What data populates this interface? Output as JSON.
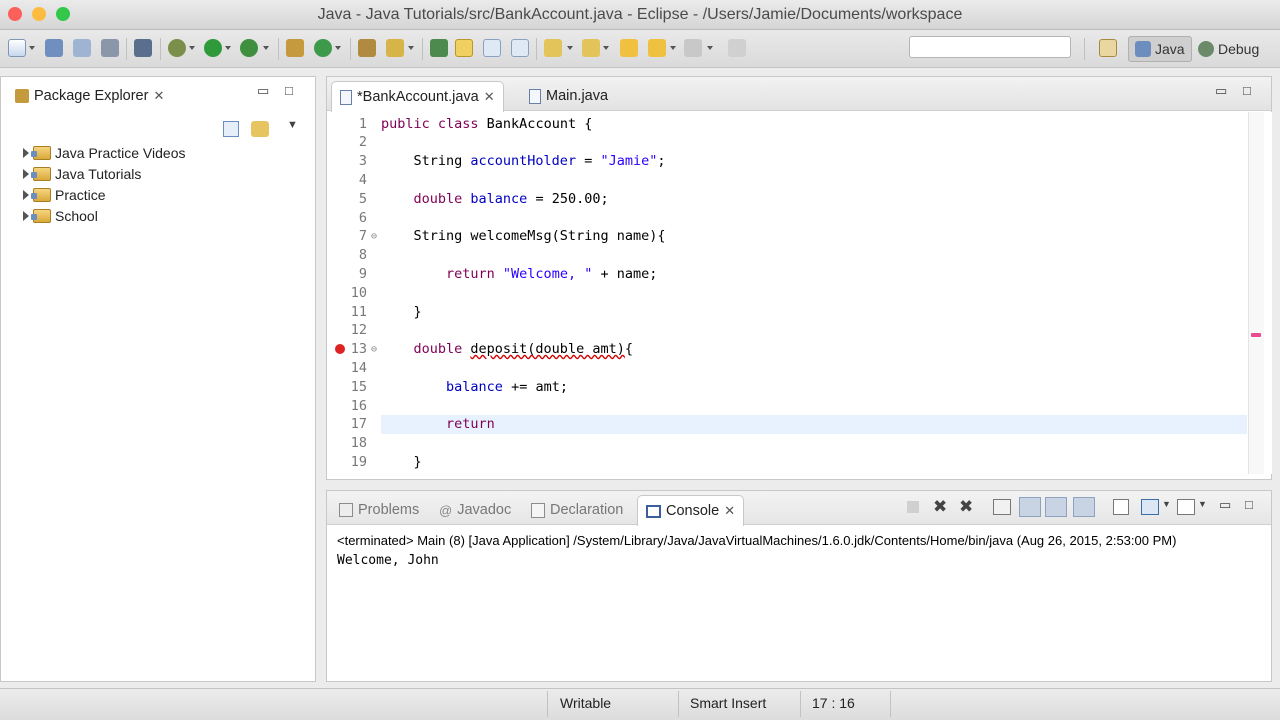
{
  "window": {
    "title": "Java - Java Tutorials/src/BankAccount.java - Eclipse - /Users/Jamie/Documents/workspace",
    "traffic_colors": [
      "#fc605b",
      "#fdbc40",
      "#34c84a"
    ]
  },
  "toolbar": {
    "search_value": "",
    "perspectives": [
      {
        "label": "Java",
        "active": true
      },
      {
        "label": "Debug",
        "active": false
      }
    ]
  },
  "package_explorer": {
    "tab_label": "Package Explorer",
    "projects": [
      {
        "label": "Java Practice Videos"
      },
      {
        "label": "Java Tutorials"
      },
      {
        "label": "Practice"
      },
      {
        "label": "School"
      }
    ]
  },
  "editor": {
    "tabs": [
      {
        "label": "*BankAccount.java",
        "active": true
      },
      {
        "label": "Main.java",
        "active": false
      }
    ],
    "current_line": 17,
    "lines": [
      {
        "n": "1",
        "tokens": [
          {
            "t": "public class ",
            "c": "kw"
          },
          {
            "t": "BankAccount {",
            "c": ""
          }
        ]
      },
      {
        "n": "2",
        "tokens": []
      },
      {
        "n": "3",
        "tokens": [
          {
            "t": "    String ",
            "c": ""
          },
          {
            "t": "accountHolder",
            "c": "fld"
          },
          {
            "t": " = ",
            "c": ""
          },
          {
            "t": "\"Jamie\"",
            "c": "str"
          },
          {
            "t": ";",
            "c": ""
          }
        ]
      },
      {
        "n": "4",
        "tokens": []
      },
      {
        "n": "5",
        "tokens": [
          {
            "t": "    double ",
            "c": "kw"
          },
          {
            "t": "balance",
            "c": "fld"
          },
          {
            "t": " = 250.00;",
            "c": ""
          }
        ]
      },
      {
        "n": "6",
        "tokens": []
      },
      {
        "n": "7",
        "fold": true,
        "tokens": [
          {
            "t": "    String welcomeMsg(String name){",
            "c": ""
          }
        ]
      },
      {
        "n": "8",
        "tokens": []
      },
      {
        "n": "9",
        "tokens": [
          {
            "t": "        return ",
            "c": "kw"
          },
          {
            "t": "\"Welcome, \"",
            "c": "str"
          },
          {
            "t": " + name;",
            "c": ""
          }
        ]
      },
      {
        "n": "10",
        "tokens": []
      },
      {
        "n": "11",
        "tokens": [
          {
            "t": "    }",
            "c": ""
          }
        ]
      },
      {
        "n": "12",
        "tokens": []
      },
      {
        "n": "13",
        "fold": true,
        "error": true,
        "tokens": [
          {
            "t": "    double ",
            "c": "kw"
          },
          {
            "t": "deposit(double amt)",
            "c": "err"
          },
          {
            "t": "{",
            "c": ""
          }
        ]
      },
      {
        "n": "14",
        "tokens": []
      },
      {
        "n": "15",
        "tokens": [
          {
            "t": "        ",
            "c": ""
          },
          {
            "t": "balance",
            "c": "fld"
          },
          {
            "t": " += amt;",
            "c": ""
          }
        ]
      },
      {
        "n": "16",
        "tokens": []
      },
      {
        "n": "17",
        "tokens": [
          {
            "t": "        return",
            "c": "kw"
          }
        ]
      },
      {
        "n": "18",
        "tokens": []
      },
      {
        "n": "19",
        "tokens": [
          {
            "t": "    }",
            "c": ""
          }
        ]
      }
    ]
  },
  "bottom_panel": {
    "tabs": [
      {
        "label": "Problems",
        "active": false
      },
      {
        "label": "Javadoc",
        "active": false
      },
      {
        "label": "Declaration",
        "active": false
      },
      {
        "label": "Console",
        "active": true
      }
    ],
    "console_header": "<terminated> Main (8) [Java Application] /System/Library/Java/JavaVirtualMachines/1.6.0.jdk/Contents/Home/bin/java (Aug 26, 2015, 2:53:00 PM)",
    "console_output": "Welcome, John"
  },
  "status": {
    "writable": "Writable",
    "insert_mode": "Smart Insert",
    "position": "17 : 16"
  }
}
